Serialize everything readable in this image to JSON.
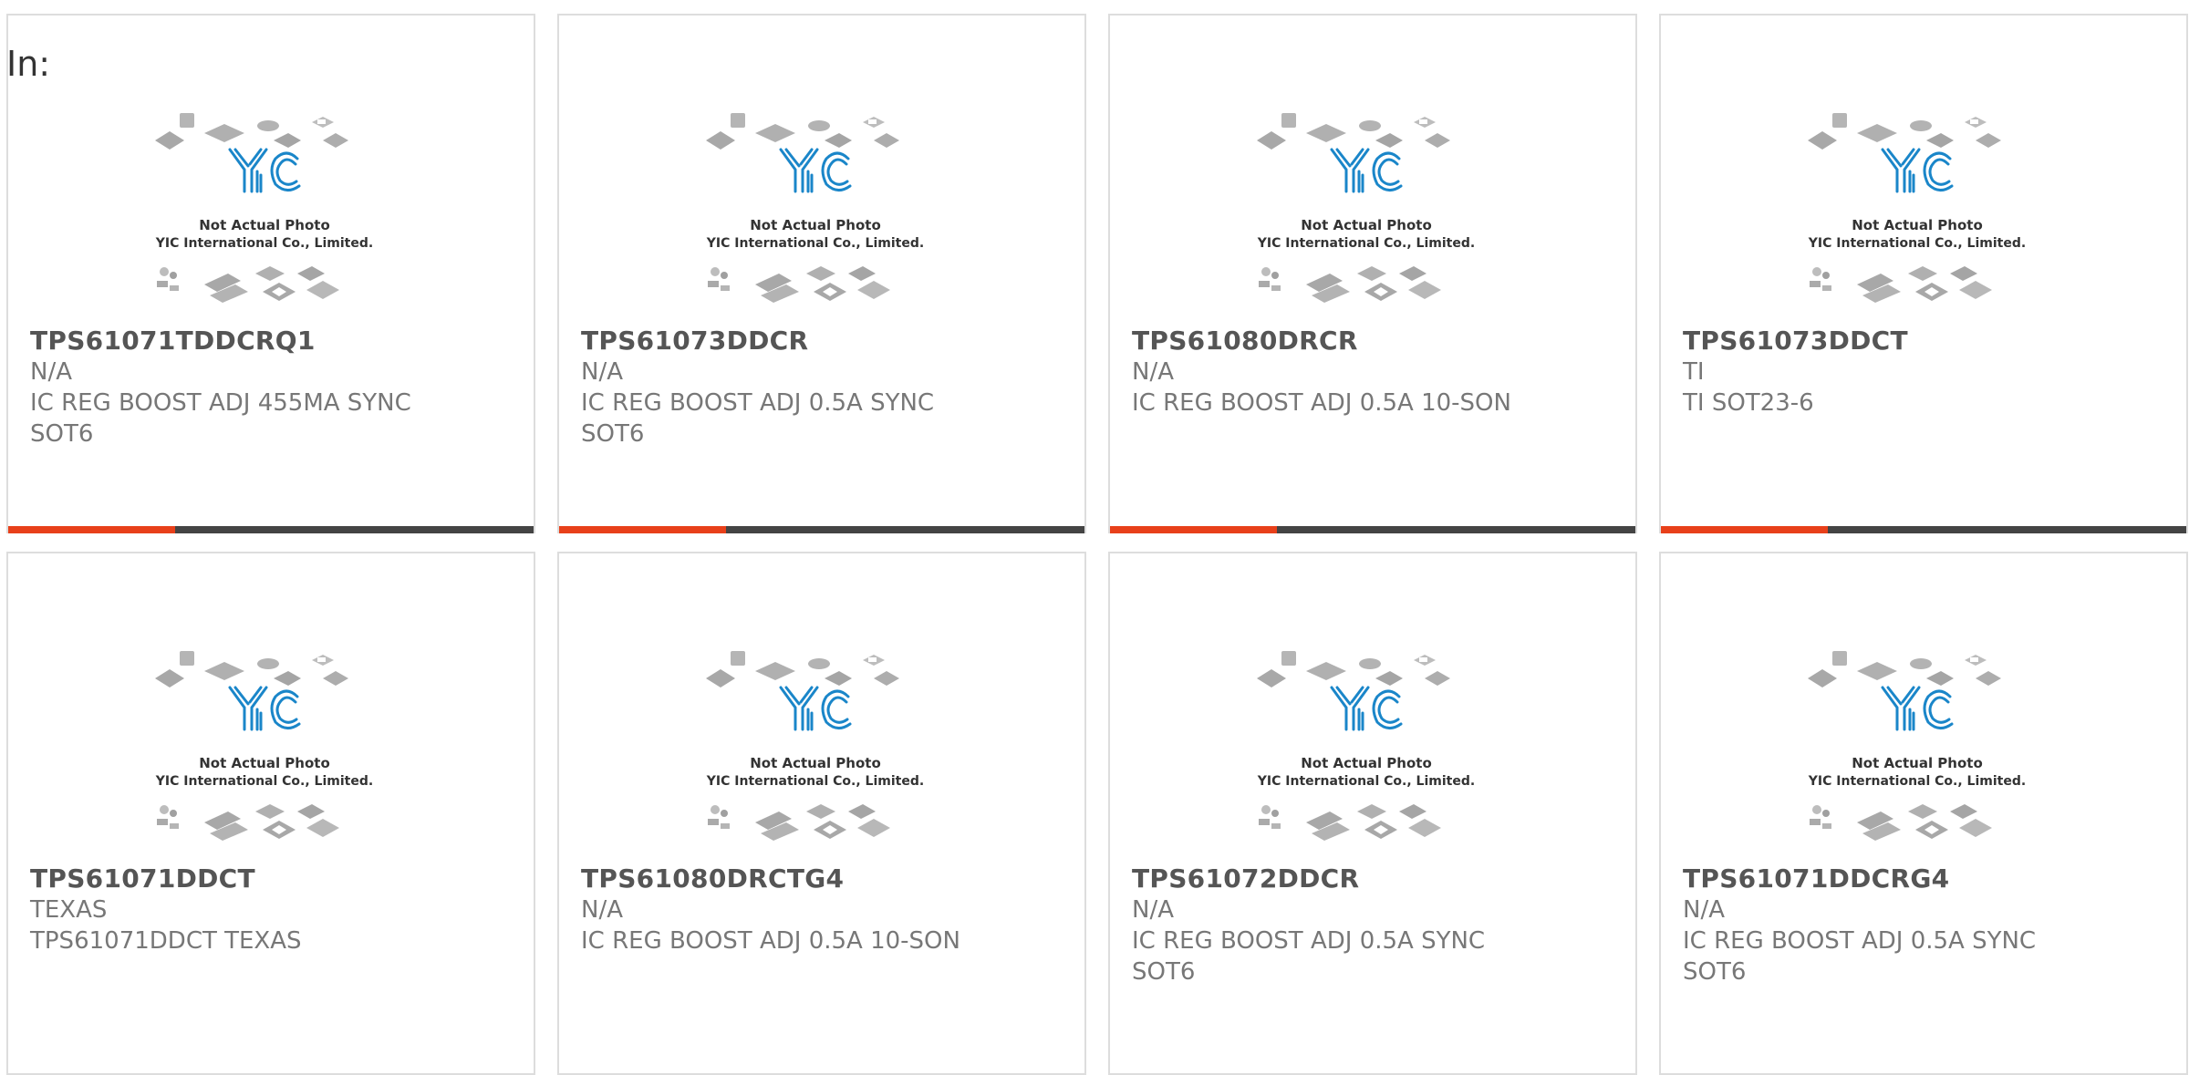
{
  "page": {
    "in_label": "In:"
  },
  "placeholder": {
    "caption_line1": "Not Actual Photo",
    "caption_line2": "YIC International Co., Limited.",
    "logo_text": "YIC"
  },
  "colors": {
    "accent": "#e8401a",
    "bar": "#444444",
    "logo": "#1a86c9",
    "chip": "#a8a8a8"
  },
  "products": [
    {
      "part": "TPS61071TDDCRQ1",
      "maker": "N/A",
      "desc": "IC REG BOOST ADJ 455MA SYNC SOT6"
    },
    {
      "part": "TPS61073DDCR",
      "maker": "N/A",
      "desc": "IC REG BOOST ADJ 0.5A SYNC SOT6"
    },
    {
      "part": "TPS61080DRCR",
      "maker": "N/A",
      "desc": "IC REG BOOST ADJ 0.5A 10-SON"
    },
    {
      "part": "TPS61073DDCT",
      "maker": "TI",
      "desc": "TI SOT23-6"
    },
    {
      "part": "TPS61071DDCT",
      "maker": "TEXAS",
      "desc": "TPS61071DDCT TEXAS"
    },
    {
      "part": "TPS61080DRCTG4",
      "maker": "N/A",
      "desc": "IC REG BOOST ADJ 0.5A 10-SON"
    },
    {
      "part": "TPS61072DDCR",
      "maker": "N/A",
      "desc": "IC REG BOOST ADJ 0.5A SYNC SOT6"
    },
    {
      "part": "TPS61071DDCRG4",
      "maker": "N/A",
      "desc": "IC REG BOOST ADJ 0.5A SYNC SOT6"
    }
  ]
}
